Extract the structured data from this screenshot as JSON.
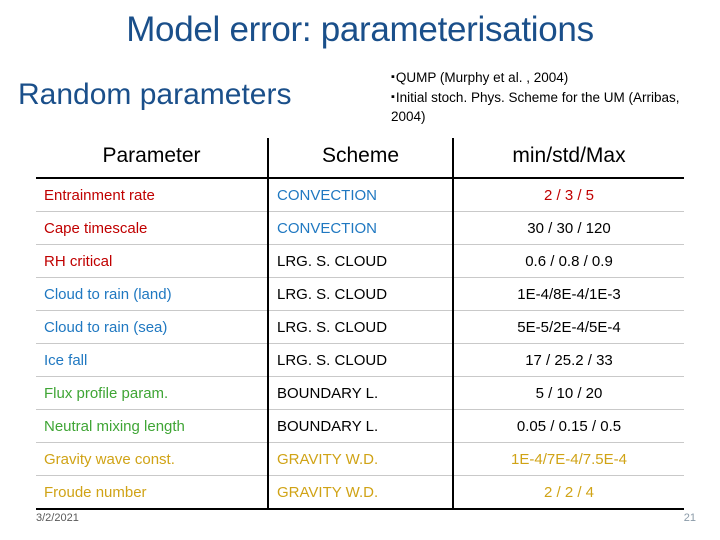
{
  "slide": {
    "title": "Model error: parameterisations",
    "subtitle": "Random parameters",
    "bullets": [
      "QUMP (Murphy et al. , 2004)",
      "Initial stoch. Phys. Scheme for the UM (Arribas, 2004)"
    ],
    "footer_date": "3/2/2021",
    "footer_page": "21"
  },
  "table": {
    "headers": [
      "Parameter",
      "Scheme",
      "min/std/Max"
    ],
    "rows": [
      {
        "parameter": "Entrainment rate",
        "scheme": "CONVECTION",
        "values": "2 / 3 / 5",
        "param_color": "red",
        "scheme_color": "blue",
        "value_color": "red"
      },
      {
        "parameter": "Cape timescale",
        "scheme": "CONVECTION",
        "values": "30 / 30 / 120",
        "param_color": "red",
        "scheme_color": "blue",
        "value_color": "black"
      },
      {
        "parameter": "RH critical",
        "scheme": "LRG. S. CLOUD",
        "values": "0.6 / 0.8 / 0.9",
        "param_color": "red",
        "scheme_color": "black",
        "value_color": "black"
      },
      {
        "parameter": "Cloud to rain (land)",
        "scheme": "LRG. S. CLOUD",
        "values": "1E-4/8E-4/1E-3",
        "param_color": "blue",
        "scheme_color": "black",
        "value_color": "black"
      },
      {
        "parameter": "Cloud to rain (sea)",
        "scheme": "LRG. S. CLOUD",
        "values": "5E-5/2E-4/5E-4",
        "param_color": "blue",
        "scheme_color": "black",
        "value_color": "black"
      },
      {
        "parameter": "Ice fall",
        "scheme": "LRG. S. CLOUD",
        "values": "17 / 25.2 / 33",
        "param_color": "blue",
        "scheme_color": "black",
        "value_color": "black"
      },
      {
        "parameter": "Flux profile param.",
        "scheme": "BOUNDARY L.",
        "values": "5 / 10 / 20",
        "param_color": "green",
        "scheme_color": "black",
        "value_color": "black"
      },
      {
        "parameter": "Neutral mixing length",
        "scheme": "BOUNDARY L.",
        "values": "0.05 / 0.15 / 0.5",
        "param_color": "green",
        "scheme_color": "black",
        "value_color": "black"
      },
      {
        "parameter": "Gravity wave const.",
        "scheme": "GRAVITY W.D.",
        "values": "1E-4/7E-4/7.5E-4",
        "param_color": "gold",
        "scheme_color": "gold",
        "value_color": "gold"
      },
      {
        "parameter": "Froude number",
        "scheme": "GRAVITY W.D.",
        "values": "2 / 2 / 4",
        "param_color": "gold",
        "scheme_color": "gold",
        "value_color": "gold"
      }
    ]
  }
}
